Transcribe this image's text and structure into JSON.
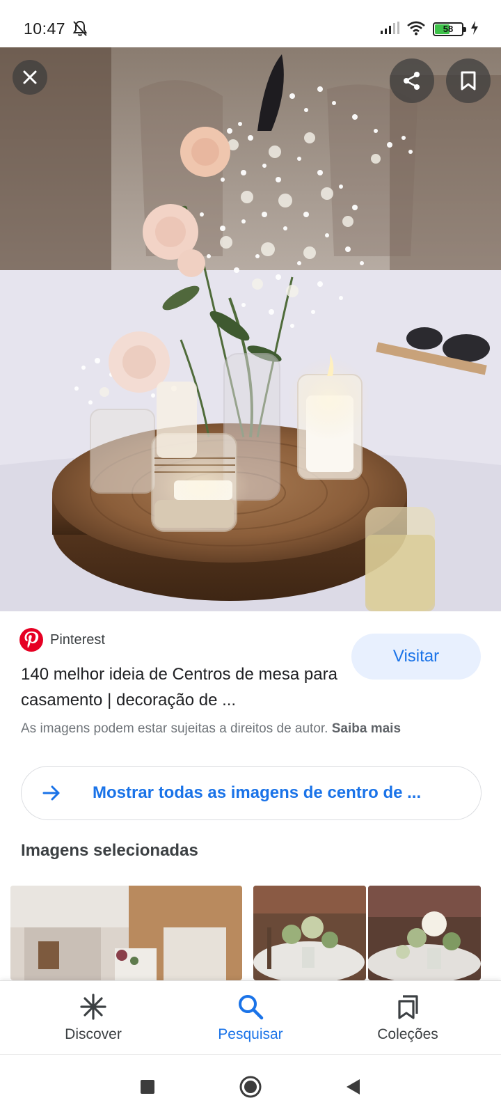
{
  "status_bar": {
    "time": "10:47",
    "battery_level": "58",
    "battery_percent": 58,
    "icons": [
      "bell-off-icon",
      "signal-icon",
      "wifi-icon",
      "battery-icon",
      "charging-icon"
    ]
  },
  "hero": {
    "actions": [
      "close-icon",
      "share-icon",
      "bookmark-icon"
    ]
  },
  "result": {
    "source": "Pinterest",
    "title": "140 melhor ideia de Centros de mesa para casamento | decoração de ...",
    "visit_label": "Visitar",
    "copyright_text": "As imagens podem estar sujeitas a direitos de autor.",
    "learn_more": "Saiba mais"
  },
  "show_all": {
    "label": "Mostrar todas as imagens de centro de ..."
  },
  "selected_images": {
    "title": "Imagens selecionadas"
  },
  "bottom_nav": {
    "items": [
      {
        "label": "Discover",
        "icon": "asterisk-icon",
        "active": false
      },
      {
        "label": "Pesquisar",
        "icon": "search-icon",
        "active": true
      },
      {
        "label": "Coleções",
        "icon": "collections-icon",
        "active": false
      }
    ]
  },
  "colors": {
    "accent": "#1a73e8",
    "visit_bg": "#e8f0fe",
    "pinterest": "#e60023",
    "text": "#202124",
    "secondary_text": "#70757a"
  }
}
